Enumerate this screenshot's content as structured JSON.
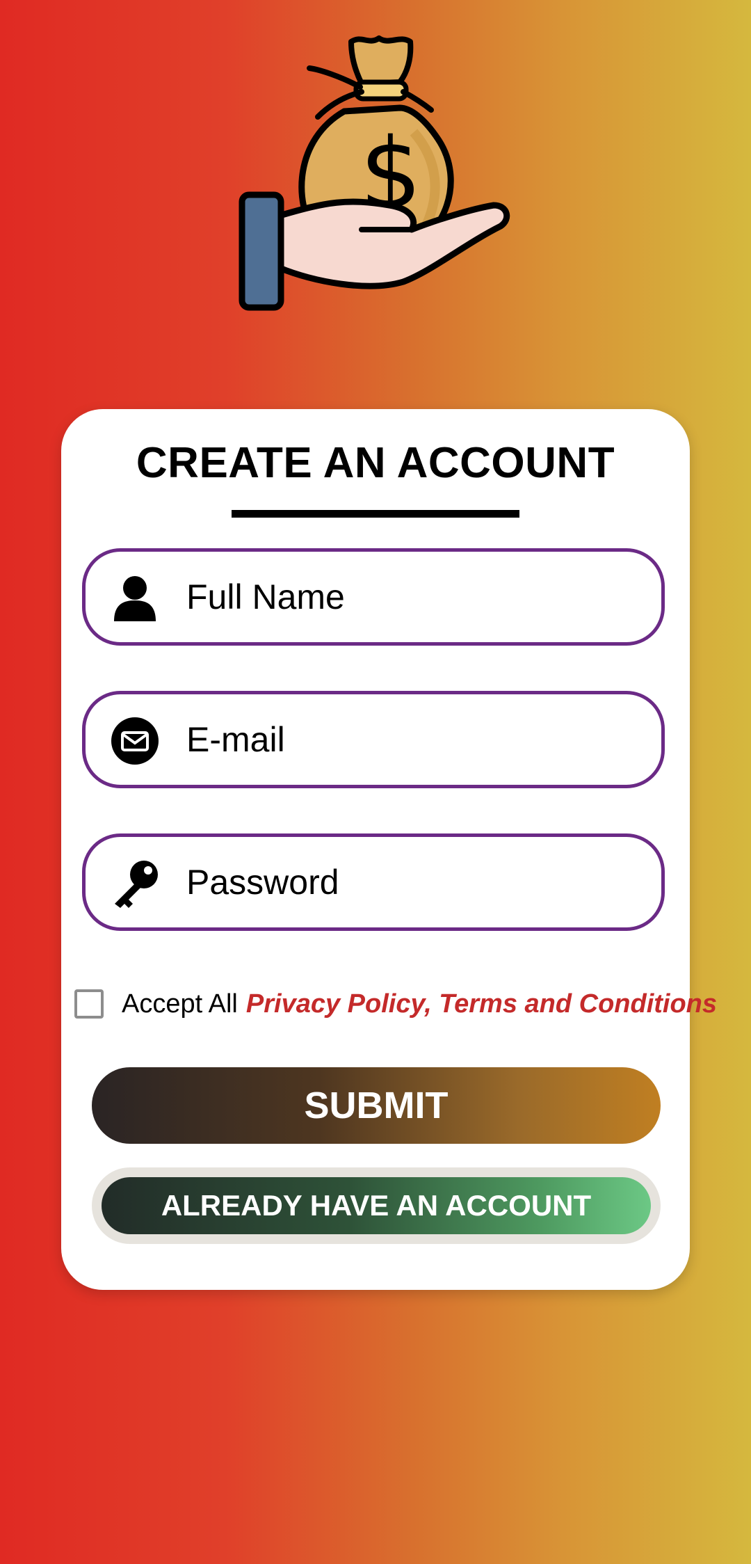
{
  "logo": {
    "icon": "money-bag-hand-icon"
  },
  "form": {
    "title": "CREATE AN ACCOUNT",
    "fields": [
      {
        "icon": "user-icon",
        "placeholder": "Full Name"
      },
      {
        "icon": "mail-icon",
        "placeholder": "E-mail"
      },
      {
        "icon": "key-icon",
        "placeholder": "Password"
      }
    ],
    "accept_label": "Accept All",
    "policy_link": "Privacy Policy, Terms and Conditions",
    "submit_label": "SUBMIT",
    "login_label": "ALREADY HAVE AN ACCOUNT"
  },
  "colors": {
    "field_border": "#6b2a86",
    "policy_link": "#c42a2a"
  }
}
